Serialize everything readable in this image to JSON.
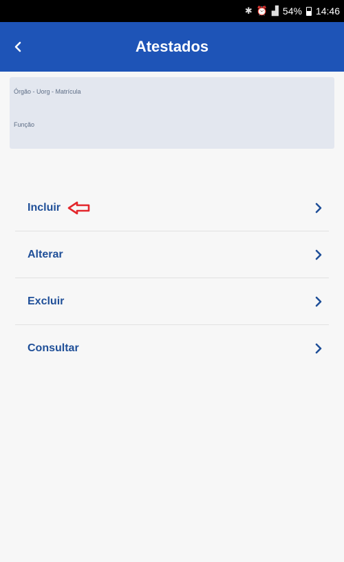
{
  "status_bar": {
    "icons": [
      "bluetooth-icon",
      "alarm-icon",
      "signal-icon"
    ],
    "battery": "54%",
    "battery_level": 0.54,
    "time": "14:46"
  },
  "header": {
    "title": "Atestados",
    "background_color": "#1e54b7"
  },
  "info_card": {
    "line1": "Órgão - Uorg - Matrícula",
    "line2": "Função"
  },
  "menu": {
    "items": [
      {
        "label": "Incluir"
      },
      {
        "label": "Alterar"
      },
      {
        "label": "Excluir"
      },
      {
        "label": "Consultar"
      }
    ],
    "label_color": "#1f4f98",
    "annotation_color": "#e3262b"
  }
}
